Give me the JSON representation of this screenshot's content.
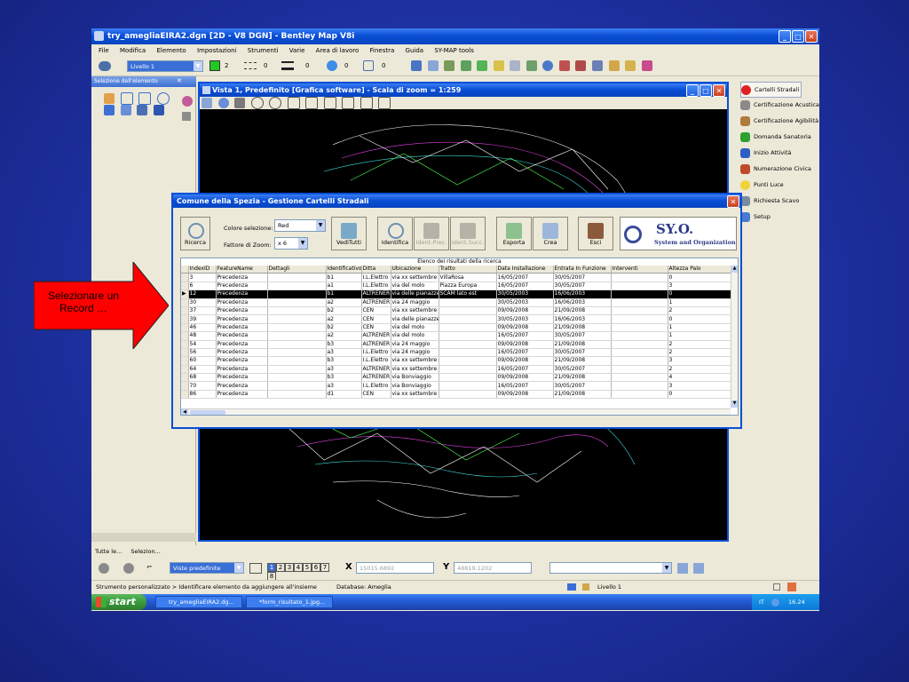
{
  "annotation": {
    "text": "Selezionare un Record …",
    "color": "#ff0000"
  },
  "app": {
    "title": "try_amegliaEIRA2.dgn [2D - V8 DGN] - Bentley Map V8i",
    "menu": [
      "File",
      "Modifica",
      "Elemento",
      "Impostazioni",
      "Strumenti",
      "Varie",
      "Area di lavoro",
      "Finestra",
      "Guida",
      "SY-MAP tools"
    ],
    "attr_toolbar": {
      "level": "Livello 1",
      "color_val": "2",
      "style_val": "0",
      "weight_val": "0",
      "trans_val": "0",
      "prio_val": "0"
    }
  },
  "left_panel": {
    "title": "Selezione dell'elemento",
    "tabs": [
      "Tutte le...",
      "Selezion..."
    ]
  },
  "right_panel": {
    "items": [
      "Cartelli Stradali",
      "Certificazione Acustica",
      "Certificazione Agibilità",
      "Domanda Sanatoria",
      "Inizio Attività",
      "Numerazione Civica",
      "Punti Luce",
      "Richiesta Scavo",
      "Setup"
    ]
  },
  "view": {
    "title": "Vista 1, Predefinito [Grafica software] - Scala di zoom = 1:259"
  },
  "dialog": {
    "title": "Comune della Spezia - Gestione Cartelli Stradali",
    "buttons": {
      "ricerca": "Ricerca",
      "veditutti": "VediTutti",
      "identifica": "Identifica",
      "ident_prec": "Ident.Prec.",
      "ident_succ": "Ident.Succ.",
      "esporta": "Esporta",
      "crea": "Crea",
      "esci": "Esci"
    },
    "color_label": "Colore selezione:",
    "color_value": "Red",
    "zoom_label": "Fattore di Zoom:",
    "zoom_value": "x 6",
    "logo": {
      "name": "SY.O.",
      "subtitle": "System and Organization"
    },
    "grid_caption": "Elenco dei risultati della ricerca",
    "columns": [
      "IndexID",
      "FeatureName",
      "Dettagli",
      "Identificativo",
      "Ditta",
      "Ubicazione",
      "Tratto",
      "Data Installazione",
      "Entrata In Funzione",
      "Interventi",
      "Altezza Palo"
    ],
    "selected_row": 2,
    "rows": [
      [
        "3",
        "Precedenza",
        "",
        "b1",
        "I.L.Elettro",
        "via xx settembre",
        "VillaRosa",
        "16/05/2007",
        "30/05/2007",
        "",
        "0"
      ],
      [
        "6",
        "Precedenza",
        "",
        "a1",
        "I.L.Elettro",
        "via del molo",
        "Piazza Europa",
        "16/05/2007",
        "30/05/2007",
        "",
        "3"
      ],
      [
        "12",
        "Precedenza",
        "",
        "b1",
        "ALTRENER",
        "via delle pianazze",
        "SCAM lato est",
        "30/05/2003",
        "16/06/2003",
        "",
        "0"
      ],
      [
        "30",
        "Precedenza",
        "",
        "a2",
        "ALTRENER",
        "via 24 maggio",
        "",
        "30/05/2003",
        "16/06/2003",
        "",
        "1"
      ],
      [
        "37",
        "Precedenza",
        "",
        "b2",
        "CEN",
        "via xx settembre",
        "",
        "09/09/2008",
        "21/09/2008",
        "",
        "2"
      ],
      [
        "39",
        "Precedenza",
        "",
        "a2",
        "CEN",
        "via delle pianazze",
        "",
        "30/05/2003",
        "16/06/2003",
        "",
        "0"
      ],
      [
        "46",
        "Precedenza",
        "",
        "b2",
        "CEN",
        "via del molo",
        "",
        "09/09/2008",
        "21/09/2008",
        "",
        "1"
      ],
      [
        "48",
        "Precedenza",
        "",
        "a2",
        "ALTRENER",
        "via del molo",
        "",
        "16/05/2007",
        "30/05/2007",
        "",
        "1"
      ],
      [
        "54",
        "Precedenza",
        "",
        "b3",
        "ALTRENER",
        "via 24 maggio",
        "",
        "09/09/2008",
        "21/09/2008",
        "",
        "2"
      ],
      [
        "56",
        "Precedenza",
        "",
        "a3",
        "I.L.Elettro",
        "via 24 maggio",
        "",
        "16/05/2007",
        "30/05/2007",
        "",
        "2"
      ],
      [
        "60",
        "Precedenza",
        "",
        "b3",
        "I.L.Elettro",
        "via xx settembre",
        "",
        "09/09/2008",
        "21/09/2008",
        "",
        "3"
      ],
      [
        "64",
        "Precedenza",
        "",
        "a3",
        "ALTRENER",
        "via xx settembre",
        "",
        "16/05/2007",
        "30/05/2007",
        "",
        "2"
      ],
      [
        "68",
        "Precedenza",
        "",
        "b3",
        "ALTRENER",
        "via Bonviaggio",
        "",
        "09/09/2008",
        "21/09/2008",
        "",
        "4"
      ],
      [
        "70",
        "Precedenza",
        "",
        "a3",
        "I.L.Elettro",
        "via Bonviaggio",
        "",
        "16/05/2007",
        "30/05/2007",
        "",
        "3"
      ],
      [
        "86",
        "Precedenza",
        "",
        "d1",
        "CEN",
        "via xx settembre",
        "",
        "09/09/2008",
        "21/09/2008",
        "",
        "0"
      ]
    ]
  },
  "bottom": {
    "views_label": "Viste predefinite",
    "view_numbers": [
      "1",
      "2",
      "3",
      "4",
      "5",
      "6",
      "7",
      "8"
    ],
    "x_label": "X",
    "x_value": "15015.6892",
    "y_label": "Y",
    "y_value": "48819.1202"
  },
  "status": {
    "left": "Strumento personalizzato > Identificare elemento da aggiungere all'insieme",
    "db": "Database: Ameglia",
    "level": "Livello 1"
  },
  "taskbar": {
    "start": "start",
    "tasks": [
      "try_amegliaEIRA2.dg...",
      "*form_risultato_1.jpg..."
    ],
    "lang": "IT",
    "clock": "16.24"
  }
}
